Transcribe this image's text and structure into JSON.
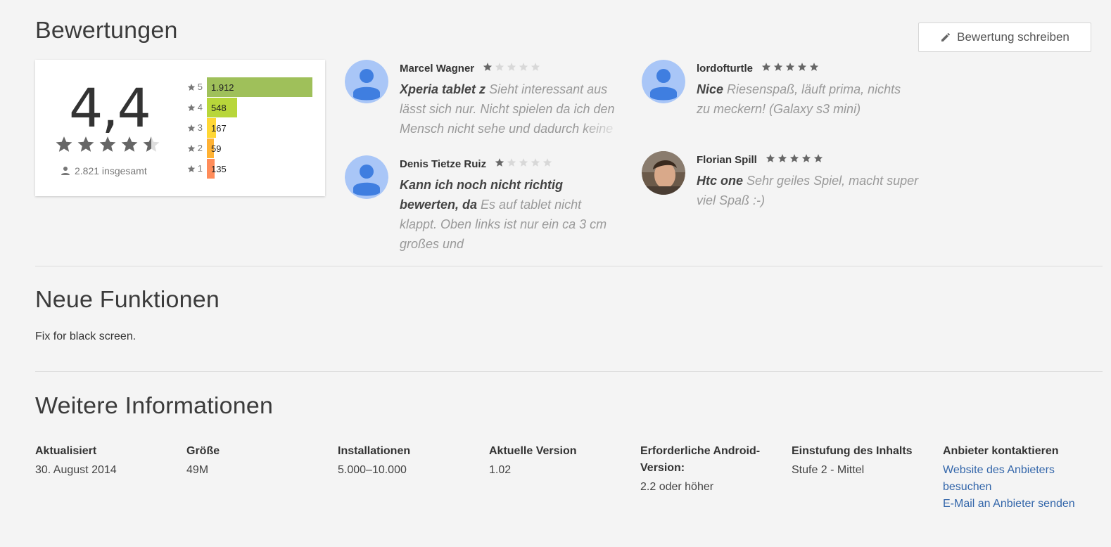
{
  "ratings": {
    "title": "Bewertungen",
    "write_review_label": "Bewertung schreiben",
    "average": "4,4",
    "total_label": "2.821 insgesamt",
    "histogram": [
      {
        "stars": "5",
        "count": "1.912",
        "fraction": 1.0,
        "color": "#9fc05a"
      },
      {
        "stars": "4",
        "count": "548",
        "fraction": 0.287,
        "color": "#b8d63a"
      },
      {
        "stars": "3",
        "count": "167",
        "fraction": 0.087,
        "color": "#ffd735"
      },
      {
        "stars": "2",
        "count": "59",
        "fraction": 0.031,
        "color": "#ffb234"
      },
      {
        "stars": "1",
        "count": "135",
        "fraction": 0.071,
        "color": "#ff8c5a"
      }
    ]
  },
  "reviews": [
    {
      "author": "Marcel Wagner",
      "rating": 1,
      "headline": "Xperia tablet z",
      "body": "Sieht interessant aus lässt sich nur. Nicht spielen da ich den Mensch nicht sehe und dadurch keine"
    },
    {
      "author": "lordofturtle",
      "rating": 5,
      "headline": "Nice",
      "body": "Riesenspaß, läuft prima, nichts zu meckern! (Galaxy s3 mini)"
    },
    {
      "author": "Denis Tietze Ruiz",
      "rating": 1,
      "headline": "Kann ich noch nicht richtig bewerten, da",
      "body": "Es auf tablet nicht klappt. Oben links ist nur ein ca 3 cm großes und"
    },
    {
      "author": "Florian Spill",
      "rating": 5,
      "headline": "Htc one",
      "body": "Sehr geiles Spiel, macht super viel Spaß :-)"
    }
  ],
  "whats_new": {
    "title": "Neue Funktionen",
    "text": "Fix for black screen."
  },
  "more_info": {
    "title": "Weitere Informationen",
    "updated_label": "Aktualisiert",
    "updated_value": "30. August 2014",
    "size_label": "Größe",
    "size_value": "49M",
    "installs_label": "Installationen",
    "installs_value": "5.000–10.000",
    "version_label": "Aktuelle Version",
    "version_value": "1.02",
    "android_label": "Erforderliche Android-Version:",
    "android_value": "2.2 oder höher",
    "content_label": "Einstufung des Inhalts",
    "content_value": "Stufe 2 - Mittel",
    "contact_label": "Anbieter kontaktieren",
    "contact_website": "Website des Anbieters besuchen",
    "contact_email": "E-Mail an Anbieter senden"
  }
}
